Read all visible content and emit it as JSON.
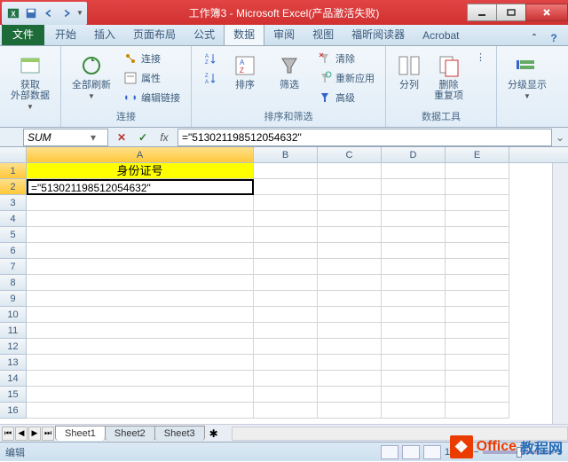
{
  "title": "工作簿3 - Microsoft Excel(产品激活失败)",
  "tabs": {
    "file": "文件",
    "home": "开始",
    "insert": "插入",
    "pagelayout": "页面布局",
    "formulas": "公式",
    "data": "数据",
    "review": "审阅",
    "view": "视图",
    "foxit": "福昕阅读器",
    "acrobat": "Acrobat"
  },
  "ribbon": {
    "get_external": {
      "label": "获取\n外部数据"
    },
    "connections": {
      "refresh_all": "全部刷新",
      "connections": "连接",
      "properties": "属性",
      "edit_links": "编辑链接",
      "group_label": "连接"
    },
    "sort_filter": {
      "sort_az": "A↓Z",
      "sort_za": "Z↓A",
      "sort": "排序",
      "filter": "筛选",
      "clear": "清除",
      "reapply": "重新应用",
      "advanced": "高级",
      "group_label": "排序和筛选"
    },
    "data_tools": {
      "text_to_columns": "分列",
      "remove_dup": "删除\n重复项",
      "group_label": "数据工具"
    },
    "outline": {
      "outline": "分级显示"
    }
  },
  "namebox": "SUM",
  "formula": "=\"513021198512054632\"",
  "columns": [
    "A",
    "B",
    "C",
    "D",
    "E"
  ],
  "rows_count": 16,
  "cells": {
    "A1": "身份证号",
    "A2_editing": "=\"513021198512054632\""
  },
  "sheets": [
    "Sheet1",
    "Sheet2",
    "Sheet3"
  ],
  "status": "编辑",
  "zoom": "100%",
  "watermark": {
    "brand1": "Office",
    "brand2": "教程网"
  }
}
